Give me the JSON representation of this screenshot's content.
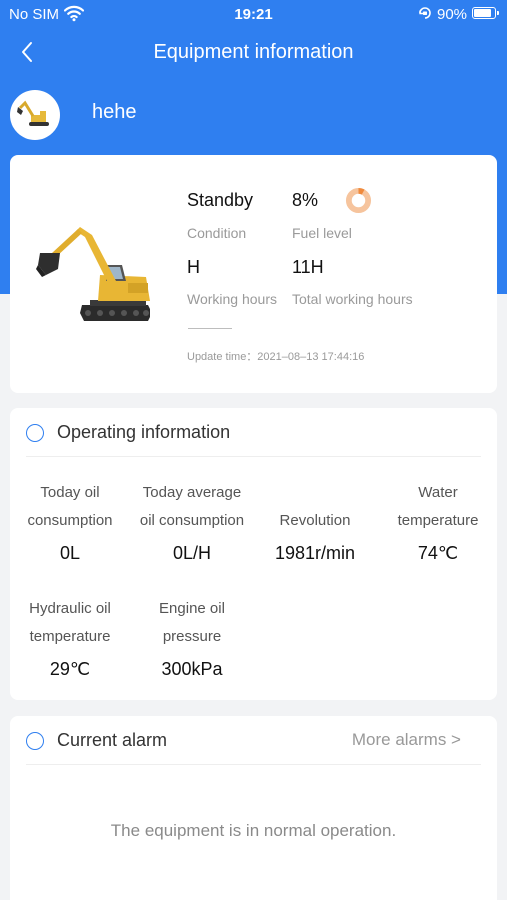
{
  "status_bar": {
    "carrier": "No SIM",
    "time": "19:21",
    "battery": "90%",
    "battery_level": 0.9,
    "icons": [
      "wifi-icon",
      "orientation-lock-icon",
      "battery-icon"
    ]
  },
  "nav": {
    "title": "Equipment information",
    "back_icon": "chevron-left-icon"
  },
  "profile": {
    "name": "hehe",
    "avatar_icon": "excavator-icon"
  },
  "equipment": {
    "condition_value": "Standby",
    "condition_label": "Condition",
    "fuel_value": "8%",
    "fuel_label": "Fuel level",
    "fuel_fraction": 0.08,
    "hours_value": "H",
    "hours_label": "Working hours",
    "total_hours_value": "11H",
    "total_hours_label": "Total working hours",
    "update_time": "Update time：2021–08–13 17:44:16"
  },
  "operating": {
    "title": "Operating information",
    "metrics": [
      {
        "label_line1": "Today oil",
        "label_line2": "consumption",
        "value": "0L"
      },
      {
        "label_line1": "Today average",
        "label_line2": "oil consumption",
        "value": "0L/H"
      },
      {
        "label_line1": "",
        "label_line2": "Revolution",
        "value": "1981r/min"
      },
      {
        "label_line1": "Water",
        "label_line2": "temperature",
        "value": "74℃"
      },
      {
        "label_line1": "Hydraulic oil",
        "label_line2": "temperature",
        "value": "29℃"
      },
      {
        "label_line1": "Engine oil",
        "label_line2": "pressure",
        "value": "300kPa"
      }
    ]
  },
  "alarm": {
    "title": "Current alarm",
    "more": "More alarms >",
    "empty_message": "The equipment is in normal operation."
  },
  "colors": {
    "header_blue": "#2f7ff0",
    "fuel_orange": "#f08a3c",
    "fuel_track": "#f6c49d"
  }
}
